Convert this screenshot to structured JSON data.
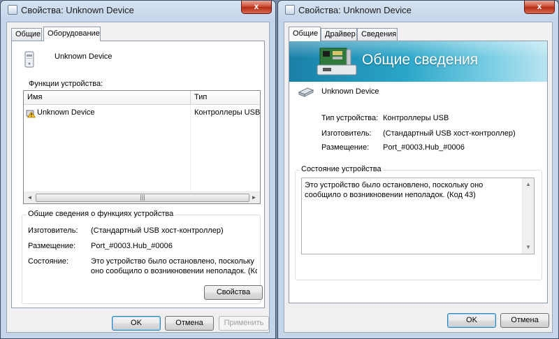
{
  "left_window": {
    "title": "Свойства: Unknown Device",
    "close_label": "x",
    "tabs": [
      {
        "label": "Общие"
      },
      {
        "label": "Оборудование"
      }
    ],
    "device_name": "Unknown Device",
    "functions_label": "Функции устройства:",
    "columns": [
      {
        "label": "Имя"
      },
      {
        "label": "Тип"
      }
    ],
    "rows": [
      {
        "name": "Unknown Device",
        "type": "Контроллеры USB"
      }
    ],
    "summary_group": "Общие сведения о функциях устройства",
    "manufacturer_label": "Изготовитель:",
    "manufacturer_value": "(Стандартный USB хост-контроллер)",
    "location_label": "Размещение:",
    "location_value": "Port_#0003.Hub_#0006",
    "status_label": "Состояние:",
    "status_line1": "Это устройство было остановлено, поскольку",
    "status_line2": "оно сообщило о возникновении неполадок. (Код",
    "properties_button": "Свойства",
    "ok_button": "OK",
    "cancel_button": "Отмена",
    "apply_button": "Применить"
  },
  "right_window": {
    "title": "Свойства: Unknown Device",
    "close_label": "x",
    "tabs": [
      {
        "label": "Общие"
      },
      {
        "label": "Драйвер"
      },
      {
        "label": "Сведения"
      }
    ],
    "banner_title": "Общие сведения",
    "device_name": "Unknown Device",
    "type_label": "Тип устройства:",
    "type_value": "Контроллеры USB",
    "manufacturer_label": "Изготовитель:",
    "manufacturer_value": "(Стандартный USB хост-контроллер)",
    "location_label": "Размещение:",
    "location_value": "Port_#0003.Hub_#0006",
    "status_group": "Состояние устройства",
    "status_text": "Это устройство было остановлено, поскольку оно сообщило о возникновении неполадок. (Код 43)",
    "ok_button": "OK",
    "cancel_button": "Отмена"
  },
  "colors": {
    "titlebar": "#c4d5ea",
    "close_button": "#c8432b",
    "banner": "#2aa6c8",
    "dialog_bg": "#f0f0f0"
  }
}
